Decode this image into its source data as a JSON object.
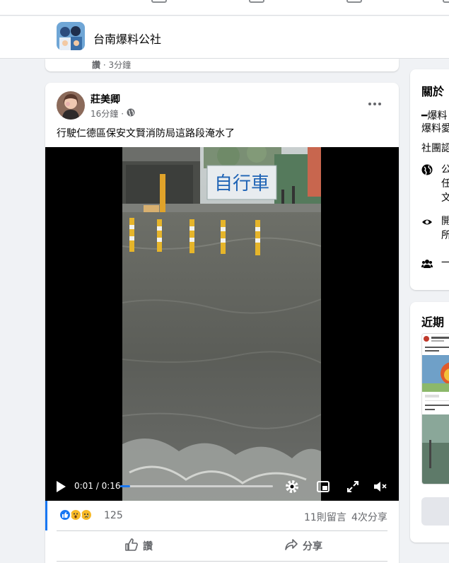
{
  "group": {
    "name": "台南爆料公社"
  },
  "previous_post": {
    "like_label": "讚",
    "separator": "·",
    "time": "3分鐘"
  },
  "post": {
    "author": "莊美卿",
    "time": "16分鐘",
    "separator": "·",
    "text": "行駛仁德區保安文賢消防局這路段淹水了",
    "video": {
      "time_label": "0:01 / 0:16",
      "progress_fraction": 0.0625,
      "sign_text": "自行車"
    },
    "reactions": {
      "count": "125",
      "types": [
        "like",
        "wow",
        "sad"
      ]
    },
    "comment_count": "11則留言",
    "share_count": "4次分享",
    "actions": {
      "like_label": "讚",
      "share_label": "分享"
    }
  },
  "sidebar": {
    "about": {
      "title": "關於",
      "desc_line1": "━爆料",
      "desc_line2": "爆料愛",
      "desc_line3": "社團認",
      "public_line1": "公",
      "public_line2": "任",
      "public_line3": "文",
      "visible_line1": "開",
      "visible_line2": "所",
      "general_line": "一"
    },
    "recent": {
      "title": "近期"
    }
  },
  "colors": {
    "accent": "#1877f2",
    "background": "#f0f2f5",
    "muted_text": "#65676b"
  }
}
